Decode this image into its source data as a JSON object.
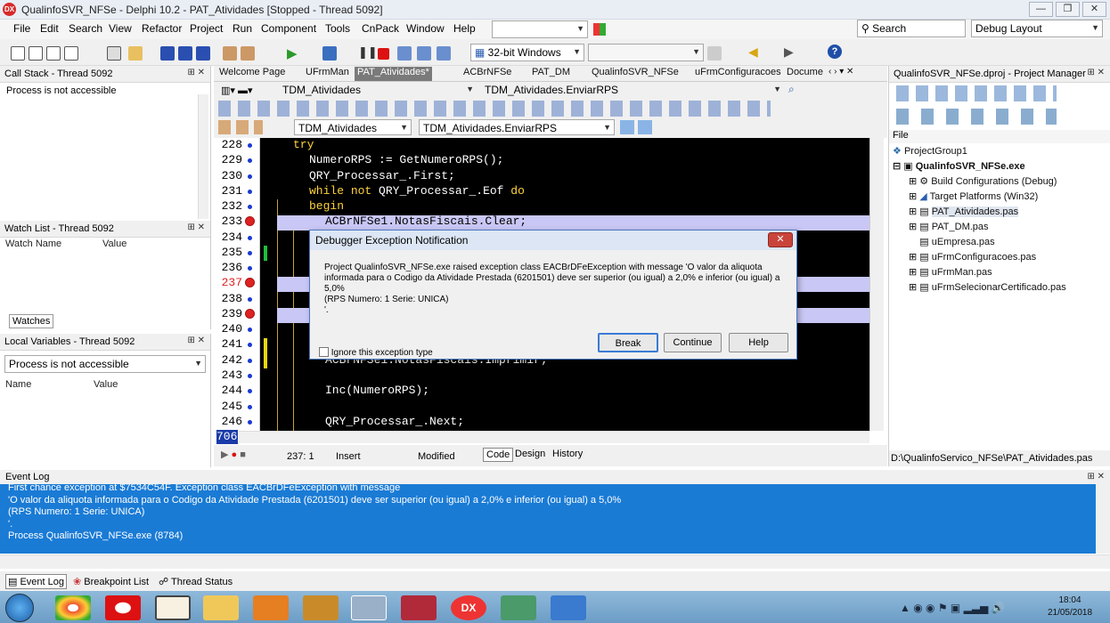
{
  "window": {
    "title": "QualinfoSVR_NFSe - Delphi 10.2 - PAT_Atividades [Stopped - Thread 5092]",
    "min": "—",
    "max": "❐",
    "close": "✕"
  },
  "menu": [
    "File",
    "Edit",
    "Search",
    "View",
    "Refactor",
    "Project",
    "Run",
    "Component",
    "Tools",
    "CnPack",
    "Window",
    "Help"
  ],
  "toolbar": {
    "platform": "32-bit Windows",
    "search_placeholder": "Search",
    "layout": "Debug Layout"
  },
  "callstack": {
    "title": "Call Stack - Thread 5092",
    "status": "Process is not accessible"
  },
  "watch": {
    "title": "Watch List - Thread 5092",
    "col_name": "Watch Name",
    "col_value": "Value",
    "tab": "Watches"
  },
  "locals": {
    "title": "Local Variables - Thread 5092",
    "combo": "Process is not accessible",
    "col_name": "Name",
    "col_value": "Value"
  },
  "tabs": [
    "Welcome Page",
    "UFrmMan",
    "PAT_Atividades*",
    "ACBrNFSe",
    "PAT_DM",
    "QualinfoSVR_NFSe",
    "uFrmConfiguracoes",
    "Docume"
  ],
  "editor_combos": {
    "unit": "TDM_Atividades",
    "method": "TDM_Atividades.EnviarRPS",
    "unit2": "TDM_Atividades",
    "method2": "TDM_Atividades.EnviarRPS"
  },
  "gutter": [
    "228",
    "229",
    "230",
    "231",
    "232",
    "233",
    "234",
    "235",
    "236",
    "237",
    "238",
    "239",
    "240",
    "241",
    "242",
    "243",
    "244",
    "245",
    "246"
  ],
  "code": {
    "l228": "try",
    "l229": "NumeroRPS := GetNumeroRPS();",
    "l230": "QRY_Processar_.First;",
    "l231a": "while",
    "l231b": "not",
    "l231c": "QRY_Processar_.Eof",
    "l231d": "do",
    "l232": "begin",
    "l233": "ACBrNFSe1.NotasFiscais.Clear;",
    "l242": "ACBrNFSe1.NotasFiscais.Imprimir;",
    "l244": "Inc(NumeroRPS);",
    "l246": "QRY_Processar_.Next;"
  },
  "current_line": "706",
  "statusbar": {
    "pos": "237:  1",
    "mode": "Insert",
    "state": "Modified",
    "tab_code": "Code",
    "tab_design": "Design",
    "tab_history": "History"
  },
  "dialog": {
    "title": "Debugger Exception Notification",
    "line1": "Project QualinfoSVR_NFSe.exe raised exception class EACBrDFeException with message 'O valor da aliquota",
    "line2": "informada para o Codigo da Atividade Prestada (6201501) deve ser superior (ou igual) a 2,0% e inferior (ou igual) a",
    "line3": "5,0%",
    "line4": "(RPS Numero: 1 Serie: UNICA)",
    "line5": "'.",
    "ignore": "Ignore this exception type",
    "break": "Break",
    "continue": "Continue",
    "help": "Help"
  },
  "project": {
    "title": "QualinfoSVR_NFSe.dproj - Project Manager",
    "file_label": "File",
    "items": [
      "ProjectGroup1",
      "QualinfoSVR_NFSe.exe",
      "Build Configurations (Debug)",
      "Target Platforms (Win32)",
      "PAT_Atividades.pas",
      "PAT_DM.pas",
      "uEmpresa.pas",
      "uFrmConfiguracoes.pas",
      "uFrmMan.pas",
      "uFrmSelecionarCertificado.pas"
    ],
    "path": "D:\\QualinfoServico_NFSe\\PAT_Atividades.pas"
  },
  "eventlog": {
    "title": "Event Log",
    "lines": [
      "First chance exception at $7534C54F. Exception class EACBrDFeException with message",
      "'O valor da aliquota informada para o Codigo da Atividade Prestada (6201501) deve ser superior (ou igual) a 2,0% e inferior (ou igual) a 5,0%",
      "(RPS Numero: 1 Serie: UNICA)",
      "'.",
      "Process QualinfoSVR_NFSe.exe (8784)"
    ],
    "tabs": [
      "Event Log",
      "Breakpoint List",
      "Thread Status"
    ]
  },
  "taskbar": {
    "time": "18:04",
    "date": "21/05/2018"
  }
}
